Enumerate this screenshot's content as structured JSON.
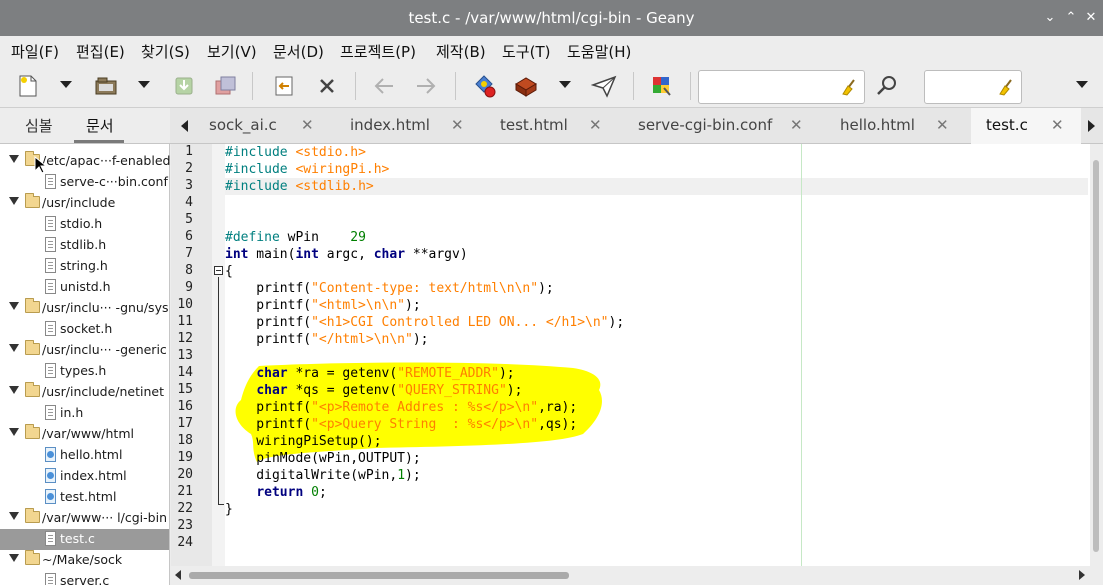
{
  "window": {
    "title": "test.c - /var/www/html/cgi-bin - Geany"
  },
  "menu": [
    "파일(F)",
    "편집(E)",
    "찾기(S)",
    "보기(V)",
    "문서(D)",
    "프로젝트(P)",
    "제작(B)",
    "도구(T)",
    "도움말(H)"
  ],
  "toolbar": {
    "icons": [
      "new-file-icon",
      "open-file-icon",
      "save-icon",
      "save-all-icon",
      "revert-icon",
      "close-file-icon",
      "back-arrow-icon",
      "forward-arrow-icon",
      "compile-icon",
      "build-icon",
      "execute-icon",
      "color-chooser-icon",
      "find-icon"
    ],
    "search_value": "",
    "goto_value": ""
  },
  "sidebar": {
    "tabs": [
      "심볼",
      "문서"
    ],
    "active_tab": "문서",
    "tree": [
      {
        "type": "folder",
        "label": "/etc/apac···f-enabled"
      },
      {
        "type": "file",
        "label": "serve-c···bin.conf"
      },
      {
        "type": "folder",
        "label": "/usr/include"
      },
      {
        "type": "file",
        "label": "stdio.h"
      },
      {
        "type": "file",
        "label": "stdlib.h"
      },
      {
        "type": "file",
        "label": "string.h"
      },
      {
        "type": "file",
        "label": "unistd.h"
      },
      {
        "type": "folder",
        "label": "/usr/inclu··· -gnu/sys"
      },
      {
        "type": "file",
        "label": "socket.h"
      },
      {
        "type": "folder",
        "label": "/usr/inclu···  -generic"
      },
      {
        "type": "file",
        "label": "types.h"
      },
      {
        "type": "folder",
        "label": "/usr/include/netinet"
      },
      {
        "type": "file",
        "label": "in.h"
      },
      {
        "type": "folder",
        "label": "/var/www/html"
      },
      {
        "type": "html",
        "label": "hello.html"
      },
      {
        "type": "html",
        "label": "index.html"
      },
      {
        "type": "html",
        "label": "test.html"
      },
      {
        "type": "folder",
        "label": "/var/www···  l/cgi-bin"
      },
      {
        "type": "file",
        "label": "test.c",
        "selected": true
      },
      {
        "type": "folder",
        "label": "~/Make/sock"
      },
      {
        "type": "file",
        "label": "server.c"
      }
    ]
  },
  "tabs": [
    {
      "label": "sock_ai.c"
    },
    {
      "label": "index.html"
    },
    {
      "label": "test.html"
    },
    {
      "label": "serve-cgi-bin.conf"
    },
    {
      "label": "hello.html"
    },
    {
      "label": "test.c",
      "active": true
    }
  ],
  "editor": {
    "current_line": 3,
    "lines": [
      [
        {
          "t": "#include ",
          "c": "pp"
        },
        {
          "t": "<stdio.h>",
          "c": "inc"
        }
      ],
      [
        {
          "t": "#include ",
          "c": "pp"
        },
        {
          "t": "<wiringPi.h>",
          "c": "inc"
        }
      ],
      [
        {
          "t": "#include ",
          "c": "pp"
        },
        {
          "t": "<stdlib.h>",
          "c": "inc"
        }
      ],
      [],
      [],
      [
        {
          "t": "#define ",
          "c": "pp"
        },
        {
          "t": "wPin    ",
          "c": "plain"
        },
        {
          "t": "29",
          "c": "num"
        }
      ],
      [
        {
          "t": "int",
          "c": "kw"
        },
        {
          "t": " main(",
          "c": "plain"
        },
        {
          "t": "int",
          "c": "kw"
        },
        {
          "t": " argc, ",
          "c": "plain"
        },
        {
          "t": "char",
          "c": "kw"
        },
        {
          "t": " **argv)",
          "c": "plain"
        }
      ],
      [
        {
          "t": "{",
          "c": "plain"
        }
      ],
      [
        {
          "t": "    printf(",
          "c": "plain"
        },
        {
          "t": "\"Content-type: text/html\\n\\n\"",
          "c": "str"
        },
        {
          "t": ");",
          "c": "plain"
        }
      ],
      [
        {
          "t": "    printf(",
          "c": "plain"
        },
        {
          "t": "\"<html>\\n\\n\"",
          "c": "str"
        },
        {
          "t": ");",
          "c": "plain"
        }
      ],
      [
        {
          "t": "    printf(",
          "c": "plain"
        },
        {
          "t": "\"<h1>CGI Controlled LED ON... </h1>\\n\"",
          "c": "str"
        },
        {
          "t": ");",
          "c": "plain"
        }
      ],
      [
        {
          "t": "    printf(",
          "c": "plain"
        },
        {
          "t": "\"</html>\\n\\n\"",
          "c": "str"
        },
        {
          "t": ");",
          "c": "plain"
        }
      ],
      [],
      [
        {
          "t": "    ",
          "c": "plain"
        },
        {
          "t": "char",
          "c": "kw"
        },
        {
          "t": " *ra = getenv(",
          "c": "plain"
        },
        {
          "t": "\"REMOTE_ADDR\"",
          "c": "str"
        },
        {
          "t": ");",
          "c": "plain"
        }
      ],
      [
        {
          "t": "    ",
          "c": "plain"
        },
        {
          "t": "char",
          "c": "kw"
        },
        {
          "t": " *qs = getenv(",
          "c": "plain"
        },
        {
          "t": "\"QUERY_STRING\"",
          "c": "str"
        },
        {
          "t": ");",
          "c": "plain"
        }
      ],
      [
        {
          "t": "    printf(",
          "c": "plain"
        },
        {
          "t": "\"<p>Remote Addres : %s</p>\\n\"",
          "c": "str"
        },
        {
          "t": ",ra);",
          "c": "plain"
        }
      ],
      [
        {
          "t": "    printf(",
          "c": "plain"
        },
        {
          "t": "\"<p>Query String  : %s</p>\\n\"",
          "c": "str"
        },
        {
          "t": ",qs);",
          "c": "plain"
        }
      ],
      [
        {
          "t": "    wiringPiSetup();",
          "c": "plain"
        }
      ],
      [
        {
          "t": "    pinMode(wPin,OUTPUT);",
          "c": "plain"
        }
      ],
      [
        {
          "t": "    digitalWrite(wPin,",
          "c": "plain"
        },
        {
          "t": "1",
          "c": "num"
        },
        {
          "t": ");",
          "c": "plain"
        }
      ],
      [
        {
          "t": "    ",
          "c": "plain"
        },
        {
          "t": "return",
          "c": "kw"
        },
        {
          "t": " ",
          "c": "plain"
        },
        {
          "t": "0",
          "c": "num"
        },
        {
          "t": ";",
          "c": "plain"
        }
      ],
      [
        {
          "t": "}",
          "c": "plain"
        }
      ],
      [],
      []
    ]
  },
  "colors": {
    "highlight": "#ffff00",
    "titlebar": "#7d7f81"
  }
}
